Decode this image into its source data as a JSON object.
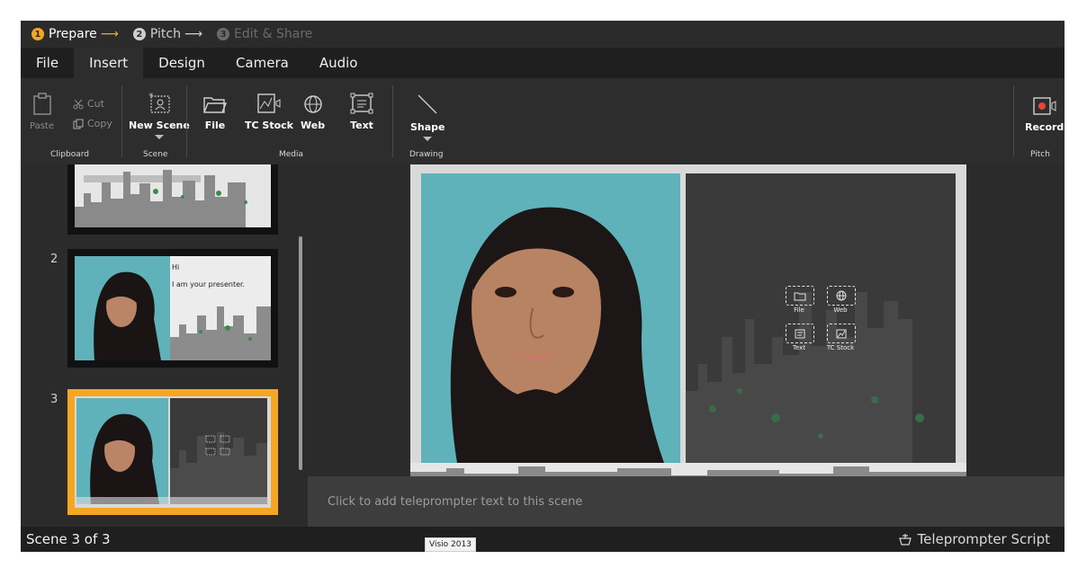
{
  "steps": [
    {
      "num": "1",
      "label": "Prepare",
      "arrow": "⟶"
    },
    {
      "num": "2",
      "label": "Pitch",
      "arrow": "⟶"
    },
    {
      "num": "3",
      "label": "Edit & Share"
    }
  ],
  "menu": [
    "File",
    "Insert",
    "Design",
    "Camera",
    "Audio"
  ],
  "ribbon": {
    "paste": "Paste",
    "cut": "Cut",
    "copy": "Copy",
    "clipboard_group": "Clipboard",
    "new_scene": "New Scene",
    "scene_group": "Scene",
    "file": "File",
    "tc_stock": "TC Stock",
    "web": "Web",
    "text": "Text",
    "media_group": "Media",
    "shape": "Shape",
    "drawing_group": "Drawing",
    "record": "Record",
    "pitch_group": "Pitch"
  },
  "scenes": [
    {
      "num": "2",
      "caption_hi": "Hi",
      "caption_line": "I am your presenter."
    },
    {
      "num": "3"
    }
  ],
  "slide": {
    "placeholders": {
      "file": "File",
      "web": "Web",
      "text": "Text",
      "tc_stock": "TC Stock"
    }
  },
  "teleprompter_placeholder": "Click to add teleprompter text to this scene",
  "status": {
    "scene_counter": "Scene 3 of 3",
    "teleprompter_script": "Teleprompter Script"
  },
  "tooltip": "Visio 2013",
  "colors": {
    "accent": "#f5a623",
    "record": "#e8443a"
  }
}
